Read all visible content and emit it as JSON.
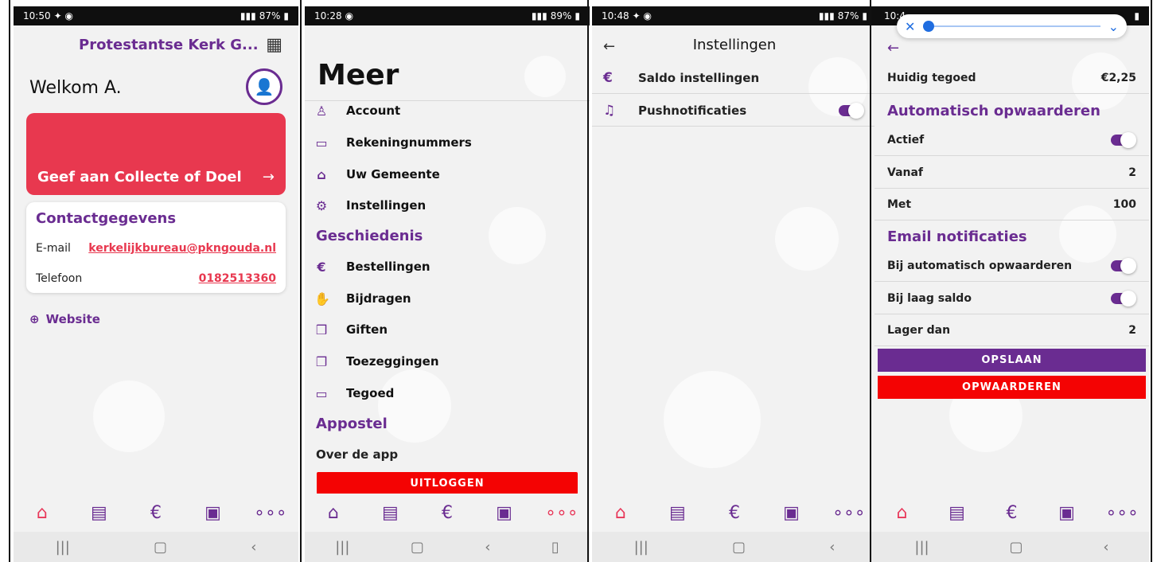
{
  "panel1": {
    "status": {
      "time": "10:50",
      "battery": "87%"
    },
    "header_title": "Protestantse Kerk G...",
    "welcome": "Welkom A.",
    "give_label": "Geef aan Collecte of Doel",
    "contact_title": "Contactgegevens",
    "email_label": "E-mail",
    "email_value": "kerkelijkbureau@pkngouda.nl",
    "phone_label": "Telefoon",
    "phone_value": "0182513360",
    "website": "Website"
  },
  "panel2": {
    "status": {
      "time": "10:28",
      "battery": "89%"
    },
    "title": "Meer",
    "menu": {
      "account": "Account",
      "accounts": "Rekeningnummers",
      "congregation": "Uw Gemeente",
      "settings": "Instellingen"
    },
    "history_title": "Geschiedenis",
    "history": {
      "orders": "Bestellingen",
      "contributions": "Bijdragen",
      "gifts": "Giften",
      "pledges": "Toezeggingen",
      "credit": "Tegoed"
    },
    "appostel_title": "Appostel",
    "about": "Over de app",
    "logout": "UITLOGGEN"
  },
  "panel3": {
    "status": {
      "time": "10:48",
      "battery": "87%"
    },
    "title": "Instellingen",
    "balance_settings": "Saldo instellingen",
    "push_notifications": "Pushnotificaties"
  },
  "panel4": {
    "status": {
      "time": "10:4",
      "battery": ""
    },
    "current_balance_label": "Huidig tegoed",
    "current_balance_value": "€2,25",
    "auto_topup_title": "Automatisch opwaarderen",
    "active_label": "Actief",
    "from_label": "Vanaf",
    "from_value": "2",
    "with_label": "Met",
    "with_value": "100",
    "email_notifications_title": "Email notificaties",
    "auto_topup_notify": "Bij automatisch opwaarderen",
    "low_balance": "Bij laag saldo",
    "lower_than_label": "Lager dan",
    "lower_than_value": "2",
    "save_button": "OPSLAAN",
    "charge_button": "OPWAARDEREN"
  },
  "colors": {
    "primary": "#6a2c91",
    "accent": "#e8384f",
    "danger": "#f40303"
  }
}
